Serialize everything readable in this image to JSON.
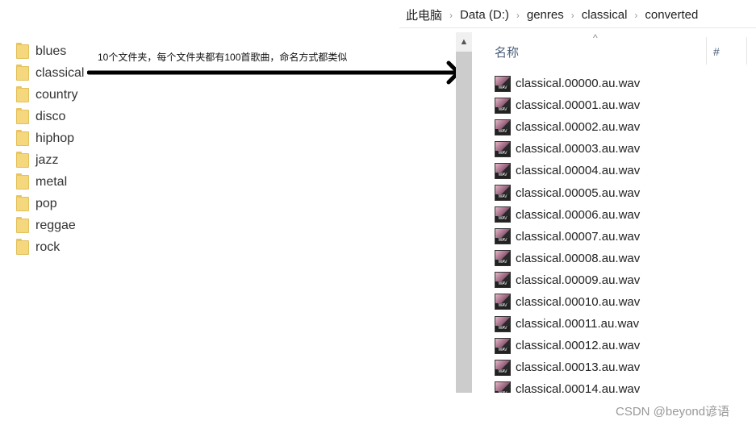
{
  "folders": [
    "blues",
    "classical",
    "country",
    "disco",
    "hiphop",
    "jazz",
    "metal",
    "pop",
    "reggae",
    "rock"
  ],
  "annotation": "10个文件夹，每个文件夹都有100首歌曲，命名方式都类似",
  "breadcrumb": [
    "此电脑",
    "Data (D:)",
    "genres",
    "classical",
    "converted"
  ],
  "columns": {
    "name": "名称",
    "number": "#"
  },
  "files": [
    "classical.00000.au.wav",
    "classical.00001.au.wav",
    "classical.00002.au.wav",
    "classical.00003.au.wav",
    "classical.00004.au.wav",
    "classical.00005.au.wav",
    "classical.00006.au.wav",
    "classical.00007.au.wav",
    "classical.00008.au.wav",
    "classical.00009.au.wav",
    "classical.00010.au.wav",
    "classical.00011.au.wav",
    "classical.00012.au.wav",
    "classical.00013.au.wav",
    "classical.00014.au.wav"
  ],
  "file_icon_label": "WAV",
  "watermark": "CSDN @beyond谚语"
}
